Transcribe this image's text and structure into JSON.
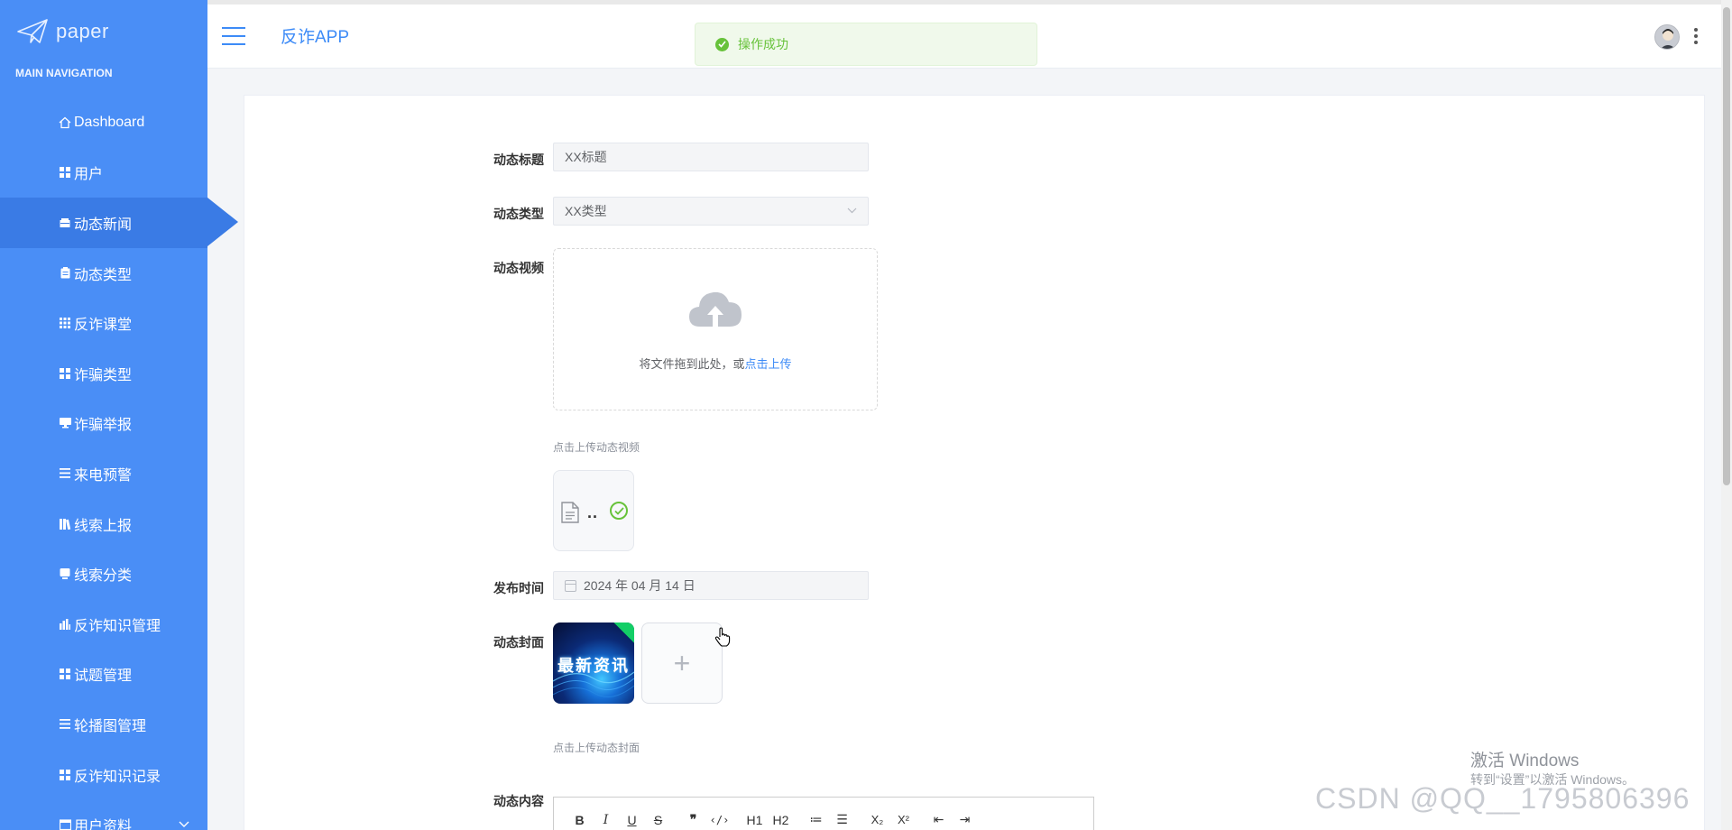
{
  "sidebar": {
    "brand": "paper",
    "caption": "MAIN NAVIGATION",
    "items": [
      {
        "label": "Dashboard",
        "icon": "home-icon"
      },
      {
        "label": "用户",
        "icon": "grid-icon"
      },
      {
        "label": "动态新闻",
        "icon": "inbox-icon"
      },
      {
        "label": "动态类型",
        "icon": "clipboard-icon"
      },
      {
        "label": "反诈课堂",
        "icon": "grid-icon"
      },
      {
        "label": "诈骗类型",
        "icon": "grid-icon"
      },
      {
        "label": "诈骗举报",
        "icon": "monitor-icon"
      },
      {
        "label": "来电预警",
        "icon": "list-icon"
      },
      {
        "label": "线索上报",
        "icon": "book-icon"
      },
      {
        "label": "线索分类",
        "icon": "tablet-icon"
      },
      {
        "label": "反诈知识管理",
        "icon": "bar-chart-icon"
      },
      {
        "label": "试题管理",
        "icon": "grid-icon"
      },
      {
        "label": "轮播图管理",
        "icon": "list-icon"
      },
      {
        "label": "反诈知识记录",
        "icon": "grid-icon"
      },
      {
        "label": "用户资料",
        "icon": "calendar-icon"
      }
    ]
  },
  "header": {
    "app_title": "反诈APP"
  },
  "toast": {
    "message": "操作成功"
  },
  "form": {
    "title_label": "动态标题",
    "title_value": "XX标题",
    "type_label": "动态类型",
    "type_value": "XX类型",
    "video_label": "动态视频",
    "upload_text": "将文件拖到此处，或",
    "upload_link": "点击上传",
    "video_tip": "点击上传动态视频",
    "file_name": "..",
    "time_label": "发布时间",
    "time_value": "2024 年 04 月 14 日",
    "cover_label": "动态封面",
    "cover_image_text": "最新资讯",
    "cover_add": "+",
    "cover_tip": "点击上传动态封面",
    "content_label": "动态内容"
  },
  "editor_toolbar": [
    "B",
    "I",
    "U",
    "S",
    "❞",
    "‹/›",
    "H1",
    "H2",
    "≔",
    "☰",
    "X₂",
    "X²",
    "⇤",
    "⇥"
  ],
  "watermark": {
    "line1": "激活 Windows",
    "line2": "转到“设置”以激活 Windows。",
    "csdn": "CSDN @QQ__1795806396"
  },
  "colors": {
    "sidebar": "#4a8ef6",
    "sidebar_active": "#3a7be5",
    "accent": "#3d8bf7",
    "success": "#67c23a"
  }
}
